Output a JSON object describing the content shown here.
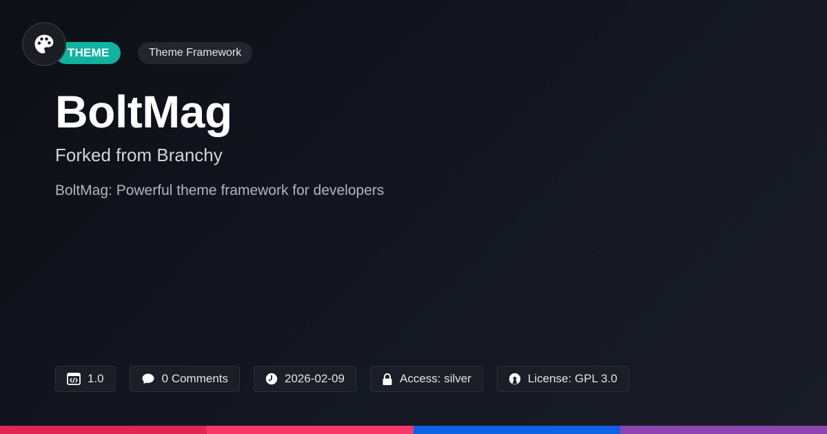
{
  "header": {
    "logo_icon": "palette-icon",
    "type_badge": "THEME",
    "category_badge": "Theme Framework"
  },
  "main": {
    "title": "BoltMag",
    "subtitle": "Forked from Branchy",
    "description": "BoltMag: Powerful theme framework for developers"
  },
  "meta": {
    "version": "1.0",
    "comments": "0 Comments",
    "date": "2026-02-09",
    "access": "Access: silver",
    "license": "License: GPL 3.0"
  },
  "colors": {
    "accent": "#10b3a0",
    "bar": [
      "#e02454",
      "#f8386a",
      "#0c63e3",
      "#8e44ad"
    ]
  }
}
